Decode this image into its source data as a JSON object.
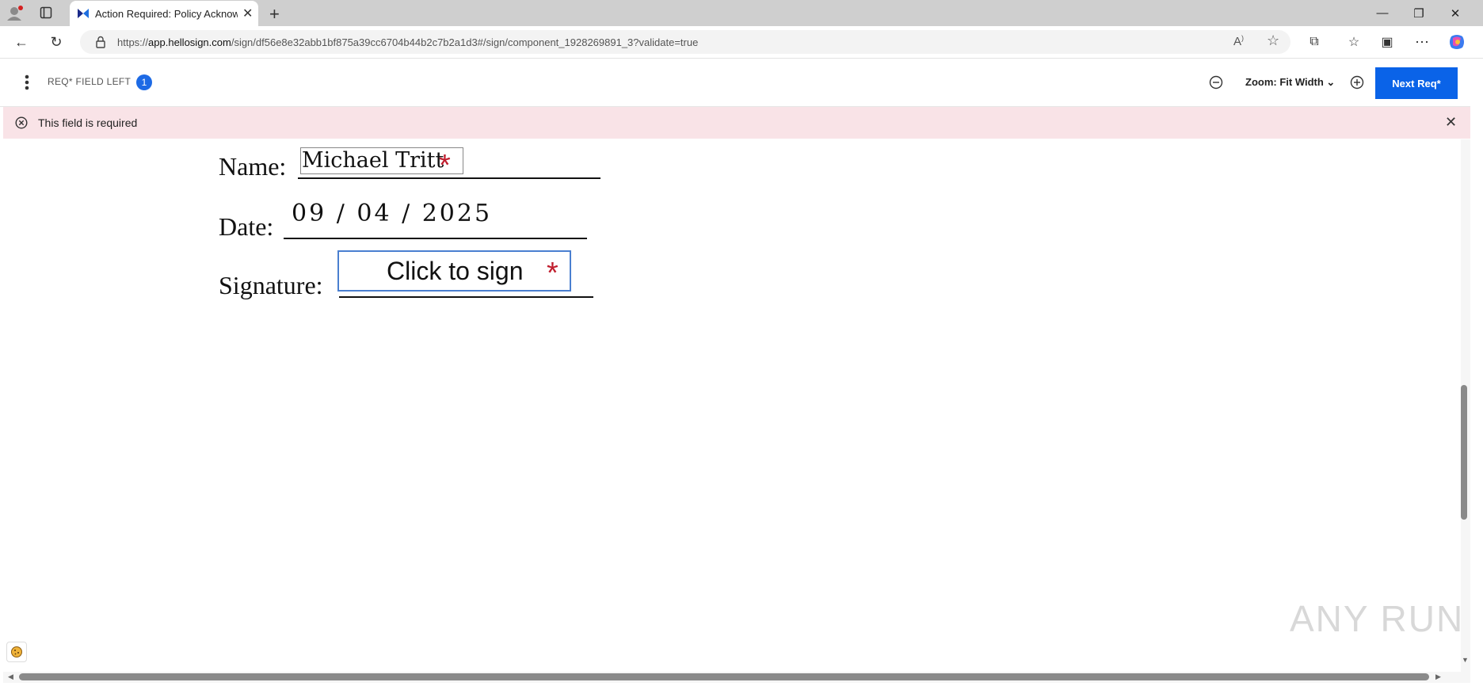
{
  "browser": {
    "tab_title": "Action Required: Policy Acknowle",
    "url_prefix": "https://",
    "url_host": "app.hellosign.com",
    "url_path": "/sign/df56e8e32abb1bf875a39cc6704b44b2c7b2a1d3#/sign/component_1928269891_3?validate=true"
  },
  "toolbar": {
    "required_label": "REQ* FIELD LEFT",
    "required_count": "1",
    "zoom_label": "Zoom: Fit Width",
    "next_label": "Next Req*"
  },
  "alert": {
    "text": "This field is required"
  },
  "document": {
    "name_label": "Name:",
    "name_value": "Michael Tritt",
    "date_label": "Date:",
    "date_value": "09 / 04 / 2025",
    "signature_label": "Signature:",
    "signature_button": "Click to sign",
    "required_marker": "*"
  },
  "watermark": "ANY RUN",
  "colors": {
    "accent": "#0a63e8",
    "alert_bg": "#f9e3e7",
    "required": "#c01e2e"
  }
}
